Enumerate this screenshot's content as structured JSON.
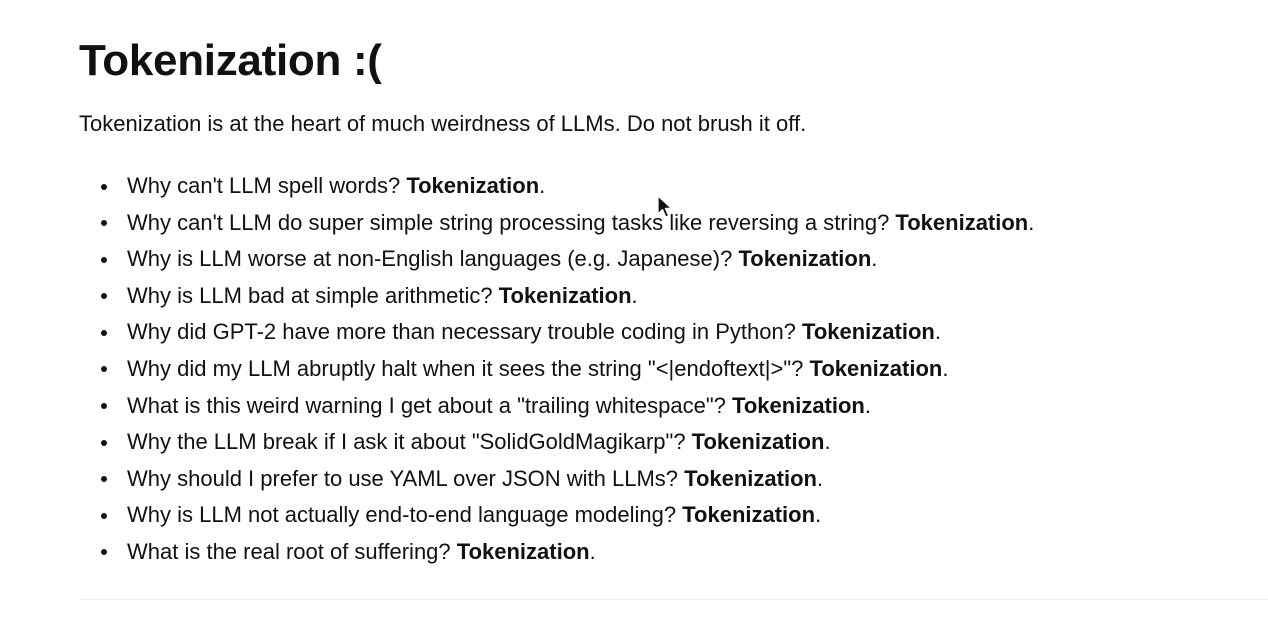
{
  "heading": {
    "title": "Tokenization :("
  },
  "intro": {
    "text": "Tokenization is at the heart of much weirdness of LLMs. Do not brush it off."
  },
  "items": [
    {
      "question": "Why can't LLM spell words? ",
      "answer": "Tokenization",
      "end": "."
    },
    {
      "question": "Why can't LLM do super simple string processing tasks like reversing a string? ",
      "answer": "Tokenization",
      "end": "."
    },
    {
      "question": "Why is LLM worse at non-English languages (e.g. Japanese)? ",
      "answer": "Tokenization",
      "end": "."
    },
    {
      "question": "Why is LLM bad at simple arithmetic? ",
      "answer": "Tokenization",
      "end": "."
    },
    {
      "question": "Why did GPT-2 have more than necessary trouble coding in Python? ",
      "answer": "Tokenization",
      "end": "."
    },
    {
      "question": "Why did my LLM abruptly halt when it sees the string \"<|endoftext|>\"? ",
      "answer": "Tokenization",
      "end": "."
    },
    {
      "question": "What is this weird warning I get about a \"trailing whitespace\"? ",
      "answer": "Tokenization",
      "end": "."
    },
    {
      "question": "Why the LLM break if I ask it about \"SolidGoldMagikarp\"? ",
      "answer": "Tokenization",
      "end": "."
    },
    {
      "question": "Why should I prefer to use YAML over JSON with LLMs? ",
      "answer": "Tokenization",
      "end": "."
    },
    {
      "question": "Why is LLM not actually end-to-end language modeling? ",
      "answer": "Tokenization",
      "end": "."
    },
    {
      "question": "What is the real root of suffering? ",
      "answer": "Tokenization",
      "end": "."
    }
  ],
  "icons": {
    "cursor": "mouse-pointer-icon"
  }
}
